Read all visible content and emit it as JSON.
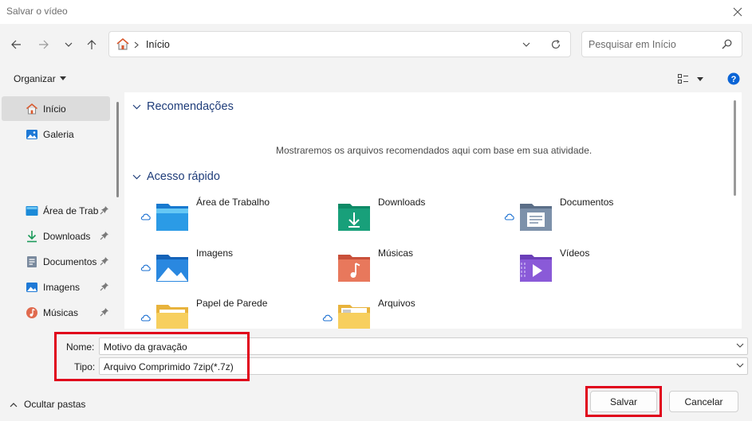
{
  "window": {
    "title": "Salvar o vídeo"
  },
  "address": {
    "location": "Início"
  },
  "search": {
    "placeholder": "Pesquisar em Início"
  },
  "toolbar": {
    "organize_label": "Organizar"
  },
  "sidebar": {
    "items": [
      {
        "label": "Início",
        "icon": "home-icon",
        "pinned": false,
        "selected": true
      },
      {
        "label": "Galeria",
        "icon": "gallery-icon",
        "pinned": false
      },
      {
        "label": "Área de Trabalho",
        "icon": "desktop-icon",
        "pinned": true
      },
      {
        "label": "Downloads",
        "icon": "download-icon",
        "pinned": true
      },
      {
        "label": "Documentos",
        "icon": "documents-icon",
        "pinned": true
      },
      {
        "label": "Imagens",
        "icon": "pictures-icon",
        "pinned": true
      },
      {
        "label": "Músicas",
        "icon": "music-icon",
        "pinned": true
      }
    ]
  },
  "main": {
    "recommendations": {
      "title": "Recomendações",
      "empty_text": "Mostraremos os arquivos recomendados aqui com base em sua atividade."
    },
    "quick_access": {
      "title": "Acesso rápido",
      "items": [
        {
          "name": "Área de Trabalho",
          "icon": "desktop-folder-icon",
          "cloud": true
        },
        {
          "name": "Downloads",
          "icon": "downloads-folder-icon",
          "cloud": false
        },
        {
          "name": "Documentos",
          "icon": "documents-folder-icon",
          "cloud": true
        },
        {
          "name": "Imagens",
          "icon": "pictures-folder-icon",
          "cloud": true
        },
        {
          "name": "Músicas",
          "icon": "music-folder-icon",
          "cloud": false
        },
        {
          "name": "Vídeos",
          "icon": "videos-folder-icon",
          "cloud": false
        },
        {
          "name": "Papel de Parede",
          "icon": "folder-icon",
          "cloud": true
        },
        {
          "name": "Arquivos",
          "icon": "folder-icon",
          "cloud": true
        }
      ]
    }
  },
  "form": {
    "name_label": "Nome:",
    "name_value": "Motivo da gravação",
    "type_label": "Tipo:",
    "type_value": "Arquivo Comprimido 7zip(*.7z)"
  },
  "footer": {
    "hide_folders_label": "Ocultar pastas",
    "save_label": "Salvar",
    "cancel_label": "Cancelar"
  },
  "colors": {
    "highlight_red": "#e0001b",
    "section_title": "#1f3d7a",
    "help_blue": "#0a64d6"
  }
}
